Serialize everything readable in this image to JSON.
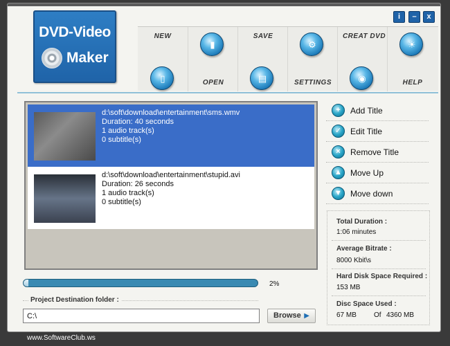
{
  "logo": {
    "line1": "DVD-Video",
    "line2": "Maker"
  },
  "window_controls": [
    {
      "id": "info",
      "glyph": "i"
    },
    {
      "id": "minimize",
      "glyph": "–"
    },
    {
      "id": "close",
      "glyph": "x"
    }
  ],
  "toolbar": {
    "new": "New",
    "open": "Open",
    "save": "Save",
    "settings": "Settings",
    "create_dvd": "Creat DVD",
    "help": "Help"
  },
  "titles": [
    {
      "path": "d:\\soft\\download\\entertainment\\sms.wmv",
      "duration": "Duration: 40 seconds",
      "audio": "1 audio track(s)",
      "subtitle": "0 subtitle(s)",
      "selected": true
    },
    {
      "path": "d:\\soft\\download\\entertainment\\stupid.avi",
      "duration": "Duration: 26 seconds",
      "audio": "1 audio track(s)",
      "subtitle": "0 subtitle(s)",
      "selected": false
    }
  ],
  "actions": {
    "add": "Add Title",
    "edit": "Edit Title",
    "remove": "Remove Title",
    "up": "Move Up",
    "down": "Move down"
  },
  "stats": {
    "total_duration_label": "Total Duration :",
    "total_duration_value": "1:06 minutes",
    "bitrate_label": "Average Bitrate :",
    "bitrate_value": "8000 Kbit\\s",
    "hdd_label": "Hard Disk Space Required :",
    "hdd_value": "153 MB",
    "disc_label": "Disc Space Used :",
    "disc_used": "67 MB",
    "disc_of": "Of",
    "disc_total": "4360 MB"
  },
  "progress": {
    "fraction": 0.02,
    "label": "2%"
  },
  "destination": {
    "label": "Project Destination folder :",
    "value": "C:\\"
  },
  "browse_label": "Browse",
  "footer": "www.SoftwareClub.ws",
  "colors": {
    "accent": "#1f63a8",
    "selection": "#3a6dc8",
    "progress": "#3a8ab2"
  }
}
